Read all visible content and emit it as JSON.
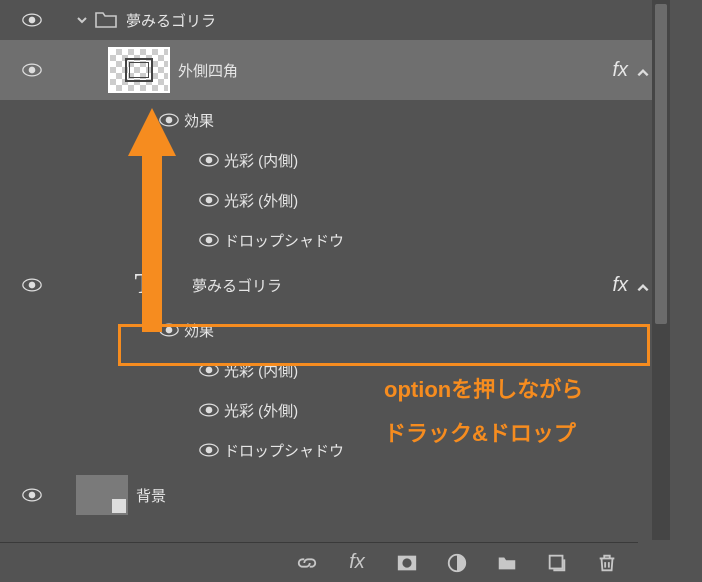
{
  "group": {
    "name": "夢みるゴリラ"
  },
  "layer1": {
    "name": "外側四角",
    "fx": "fx",
    "effects_header": "効果",
    "effects": [
      "光彩 (内側)",
      "光彩 (外側)",
      "ドロップシャドウ"
    ]
  },
  "layer2": {
    "name": "夢みるゴリラ",
    "text_glyph": "T",
    "fx": "fx",
    "effects_header": "効果",
    "effects": [
      "光彩 (内側)",
      "光彩 (外側)",
      "ドロップシャドウ"
    ]
  },
  "bg": {
    "name": "背景"
  },
  "annotation": {
    "line1": "optionを押しながら",
    "line2": "ドラック&ドロップ"
  },
  "footer": {
    "fx": "fx"
  }
}
